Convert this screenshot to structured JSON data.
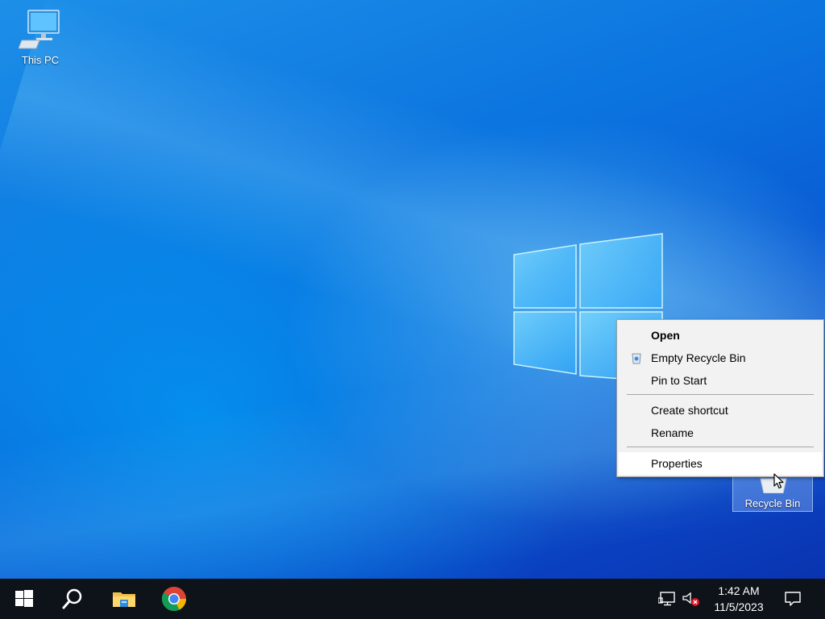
{
  "desktop": {
    "icons": [
      {
        "label": "This PC"
      },
      {
        "label": "Recycle Bin"
      }
    ]
  },
  "context_menu": {
    "items": [
      {
        "label": "Open",
        "bold": true
      },
      {
        "label": "Empty Recycle Bin"
      },
      {
        "label": "Pin to Start"
      },
      {
        "label": "Create shortcut"
      },
      {
        "label": "Rename"
      },
      {
        "label": "Properties",
        "highlighted": true
      }
    ]
  },
  "taskbar": {
    "pinned": [
      "windows-start-icon",
      "search-icon",
      "file-explorer-icon",
      "chrome-icon"
    ],
    "tray": {
      "icons": [
        "network-icon",
        "volume-muted-icon"
      ],
      "time": "1:42 AM",
      "date": "11/5/2023"
    }
  },
  "colors": {
    "taskbar_bg": "#0e1319",
    "menu_bg": "#f2f2f2",
    "menu_highlight": "#ffffff",
    "desktop_blue": "#0b74df"
  }
}
